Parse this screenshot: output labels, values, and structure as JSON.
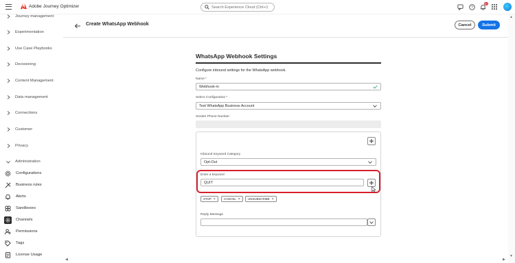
{
  "app": {
    "title": "Adobe Journey Optimizer",
    "search_placeholder": "Search Experience Cloud (Ctrl+/)",
    "notification_count": "9+",
    "brand_color": "#eb1000",
    "accent_color": "#1473e6"
  },
  "sidebar": {
    "groups": [
      {
        "label": "Journey management"
      },
      {
        "label": "Experimentation"
      },
      {
        "label": "Use Case Playbooks"
      },
      {
        "label": "Decisioning"
      },
      {
        "label": "Content Management"
      },
      {
        "label": "Data management"
      },
      {
        "label": "Connections"
      },
      {
        "label": "Customer"
      },
      {
        "label": "Privacy"
      },
      {
        "label": "Administration"
      }
    ],
    "admin_items": [
      {
        "label": "Configurations",
        "icon": "configurations-icon"
      },
      {
        "label": "Business rules",
        "icon": "business-rules-icon"
      },
      {
        "label": "Alerts",
        "icon": "bell-icon"
      },
      {
        "label": "Sandboxes",
        "icon": "sandboxes-icon"
      },
      {
        "label": "Channels",
        "icon": "channels-icon",
        "active": true
      },
      {
        "label": "Permissions",
        "icon": "permissions-icon"
      },
      {
        "label": "Tags",
        "icon": "tag-icon"
      },
      {
        "label": "License Usage",
        "icon": "license-usage-icon"
      }
    ]
  },
  "header": {
    "title": "Create WhatsApp Webhook",
    "cancel_label": "Cancel",
    "submit_label": "Submit"
  },
  "form": {
    "title": "WhatsApp Webhook Settings",
    "description": "Configure inbound settings for the WhatsApp webhook.",
    "name_label": "Name",
    "name_value": "Webhook-m",
    "config_label": "Select Configuration",
    "config_value": "Test WhatsApp Business Account",
    "sender_label": "Sender Phone Number",
    "sender_value": "",
    "required_mark": "*",
    "keyword_category_label": "Inbound Keyword Category",
    "keyword_category_value": "Opt-Out",
    "keyword_label": "Enter a keyword",
    "keyword_value": "QUIT",
    "keywords": [
      "STOP",
      "CANCEL",
      "UNSUBSCRIBE"
    ],
    "reply_label": "Reply Message",
    "reply_value": ""
  }
}
